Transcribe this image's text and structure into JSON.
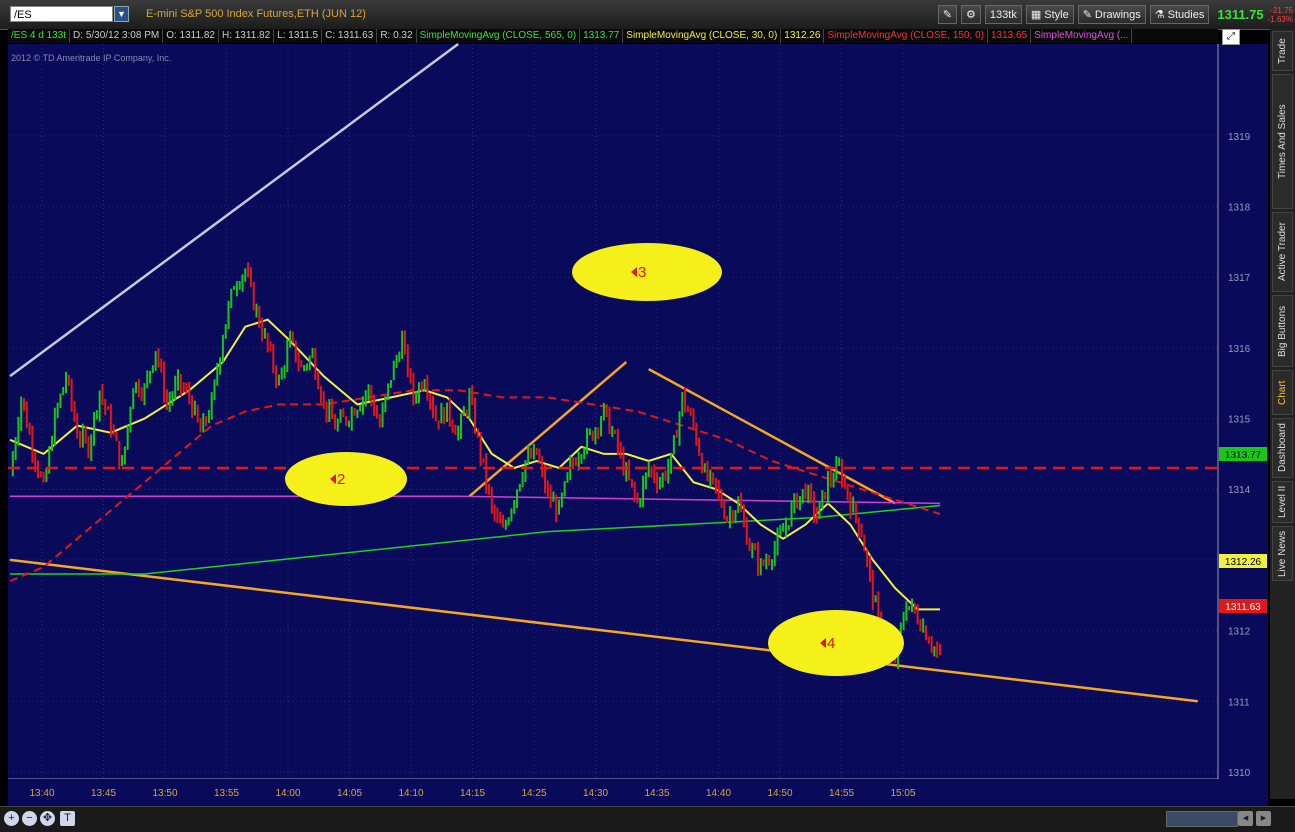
{
  "header": {
    "symbol": "/ES",
    "description": "E-mini S&P 500 Index Futures,ETH (JUN 12)",
    "aggregation": "133tk",
    "style_label": "Style",
    "drawings_label": "Drawings",
    "studies_label": "Studies",
    "last_price": "1311.75",
    "change": "-21.75",
    "change_pct": "-1.63%"
  },
  "infobar": {
    "period": "/ES 4 d 133t",
    "date": "D: 5/30/12 3:08 PM",
    "open": "O: 1311.82",
    "high": "H: 1311.82",
    "low": "L: 1311.5",
    "close": "C: 1311.63",
    "range": "R: 0.32",
    "sma565_label": "SimpleMovingAvg (CLOSE, 565, 0)",
    "sma565_val": "1313.77",
    "sma30_label": "SimpleMovingAvg (CLOSE, 30, 0)",
    "sma30_val": "1312.26",
    "sma150_label": "SimpleMovingAvg (CLOSE, 150, 0)",
    "sma150_val": "1313.65",
    "sma_other_label": "SimpleMovingAvg (..."
  },
  "copyright": "2012 © TD Ameritrade IP Company, Inc.",
  "side_tabs": [
    "Trade",
    "Times And Sales",
    "Active Trader",
    "Big Buttons",
    "Chart",
    "Dashboard",
    "Level II",
    "Live News"
  ],
  "price_tags": {
    "sma565": "1313.77",
    "sma30": "1312.26",
    "last": "1311.63"
  },
  "annotations": [
    "2",
    "3",
    "4"
  ],
  "colors": {
    "background": "#0a0a5a",
    "up_bar": "#19c619",
    "down_bar": "#e01818",
    "sma30": "#f0f040",
    "sma150": "#e01818",
    "sma565": "#1fd11f",
    "magenta_line": "#d040d0",
    "trendline": "#f5a623",
    "ellipse": "#f5f01a"
  },
  "chart_data": {
    "type": "line",
    "title": "",
    "xlabel": "",
    "ylabel": "",
    "ylim": [
      1309.9,
      1320.3
    ],
    "yticks": [
      1310,
      1311,
      1312,
      1313,
      1314,
      1315,
      1316,
      1317,
      1318,
      1319
    ],
    "x_tick_labels": [
      "13:40",
      "13:45",
      "13:50",
      "13:55",
      "14:00",
      "14:05",
      "14:10",
      "14:15",
      "14:25",
      "14:30",
      "14:35",
      "14:40",
      "14:50",
      "14:55",
      "15:05"
    ],
    "price_path": [
      [
        0,
        1314.2
      ],
      [
        1,
        1315.3
      ],
      [
        2,
        1314.6
      ],
      [
        3,
        1314.0
      ],
      [
        4,
        1315.0
      ],
      [
        5,
        1315.6
      ],
      [
        6,
        1314.8
      ],
      [
        7,
        1314.6
      ],
      [
        8,
        1315.4
      ],
      [
        9,
        1314.9
      ],
      [
        10,
        1314.3
      ],
      [
        11,
        1315.5
      ],
      [
        12,
        1315.4
      ],
      [
        13,
        1316.0
      ],
      [
        14,
        1315.2
      ],
      [
        15,
        1315.5
      ],
      [
        16,
        1315.3
      ],
      [
        17,
        1314.8
      ],
      [
        18,
        1315.2
      ],
      [
        19,
        1316.2
      ],
      [
        20,
        1316.9
      ],
      [
        21,
        1317.1
      ],
      [
        22,
        1316.5
      ],
      [
        23,
        1316.0
      ],
      [
        24,
        1315.5
      ],
      [
        25,
        1316.1
      ],
      [
        26,
        1315.7
      ],
      [
        27,
        1315.9
      ],
      [
        28,
        1315.2
      ],
      [
        29,
        1314.9
      ],
      [
        30,
        1315.0
      ],
      [
        31,
        1315.2
      ],
      [
        32,
        1315.4
      ],
      [
        33,
        1314.9
      ],
      [
        34,
        1315.6
      ],
      [
        35,
        1316.1
      ],
      [
        36,
        1315.3
      ],
      [
        37,
        1315.6
      ],
      [
        38,
        1315.0
      ],
      [
        39,
        1315.1
      ],
      [
        40,
        1314.8
      ],
      [
        41,
        1315.3
      ],
      [
        42,
        1314.5
      ],
      [
        43,
        1313.7
      ],
      [
        44,
        1313.4
      ],
      [
        45,
        1313.9
      ],
      [
        46,
        1314.4
      ],
      [
        47,
        1314.5
      ],
      [
        48,
        1313.9
      ],
      [
        49,
        1313.7
      ],
      [
        50,
        1314.3
      ],
      [
        51,
        1314.6
      ],
      [
        52,
        1314.8
      ],
      [
        53,
        1315.1
      ],
      [
        54,
        1314.7
      ],
      [
        55,
        1314.2
      ],
      [
        56,
        1313.8
      ],
      [
        57,
        1314.3
      ],
      [
        58,
        1314.1
      ],
      [
        59,
        1314.4
      ],
      [
        60,
        1315.3
      ],
      [
        61,
        1314.9
      ],
      [
        62,
        1314.2
      ],
      [
        63,
        1314.0
      ],
      [
        64,
        1313.6
      ],
      [
        65,
        1313.8
      ],
      [
        66,
        1313.2
      ],
      [
        67,
        1312.9
      ],
      [
        68,
        1313.1
      ],
      [
        69,
        1313.4
      ],
      [
        70,
        1313.8
      ],
      [
        71,
        1314.0
      ],
      [
        72,
        1313.6
      ],
      [
        73,
        1314.1
      ],
      [
        74,
        1314.3
      ],
      [
        75,
        1313.8
      ],
      [
        76,
        1313.4
      ],
      [
        77,
        1312.5
      ],
      [
        78,
        1311.8
      ],
      [
        79,
        1311.6
      ],
      [
        80,
        1312.4
      ],
      [
        81,
        1312.2
      ],
      [
        82,
        1311.9
      ],
      [
        83,
        1311.6
      ]
    ],
    "series": [
      {
        "name": "SimpleMovingAvg (CLOSE, 30, 0)",
        "points": [
          [
            0,
            1314.7
          ],
          [
            3,
            1314.5
          ],
          [
            6,
            1314.9
          ],
          [
            9,
            1314.8
          ],
          [
            12,
            1315.0
          ],
          [
            16,
            1315.4
          ],
          [
            19,
            1315.8
          ],
          [
            21,
            1316.3
          ],
          [
            23,
            1316.4
          ],
          [
            25,
            1316.1
          ],
          [
            28,
            1315.6
          ],
          [
            31,
            1315.2
          ],
          [
            34,
            1315.3
          ],
          [
            37,
            1315.4
          ],
          [
            39,
            1315.3
          ],
          [
            41,
            1315.0
          ],
          [
            43,
            1314.5
          ],
          [
            45,
            1314.3
          ],
          [
            47,
            1314.4
          ],
          [
            49,
            1314.3
          ],
          [
            51,
            1314.6
          ],
          [
            53,
            1314.5
          ],
          [
            55,
            1314.5
          ],
          [
            57,
            1314.4
          ],
          [
            59,
            1314.5
          ],
          [
            61,
            1314.1
          ],
          [
            63,
            1314.0
          ],
          [
            65,
            1313.8
          ],
          [
            67,
            1313.5
          ],
          [
            69,
            1313.3
          ],
          [
            71,
            1313.5
          ],
          [
            73,
            1313.8
          ],
          [
            75,
            1313.5
          ],
          [
            77,
            1313.0
          ],
          [
            79,
            1312.6
          ],
          [
            81,
            1312.3
          ],
          [
            83,
            1312.3
          ]
        ]
      },
      {
        "name": "SimpleMovingAvg (CLOSE, 150, 0)",
        "points": [
          [
            0,
            1312.7
          ],
          [
            3,
            1312.9
          ],
          [
            6,
            1313.3
          ],
          [
            9,
            1313.7
          ],
          [
            12,
            1314.1
          ],
          [
            15,
            1314.5
          ],
          [
            18,
            1314.9
          ],
          [
            21,
            1315.1
          ],
          [
            24,
            1315.2
          ],
          [
            28,
            1315.2
          ],
          [
            32,
            1315.3
          ],
          [
            36,
            1315.4
          ],
          [
            40,
            1315.4
          ],
          [
            44,
            1315.3
          ],
          [
            48,
            1315.3
          ],
          [
            52,
            1315.2
          ],
          [
            56,
            1315.1
          ],
          [
            60,
            1314.9
          ],
          [
            64,
            1314.7
          ],
          [
            68,
            1314.4
          ],
          [
            72,
            1314.2
          ],
          [
            76,
            1314.0
          ],
          [
            80,
            1313.8
          ],
          [
            83,
            1313.65
          ]
        ]
      },
      {
        "name": "SimpleMovingAvg (CLOSE, 565, 0)",
        "points": [
          [
            0,
            1312.8
          ],
          [
            12,
            1312.8
          ],
          [
            24,
            1313.0
          ],
          [
            36,
            1313.2
          ],
          [
            48,
            1313.4
          ],
          [
            60,
            1313.5
          ],
          [
            72,
            1313.6
          ],
          [
            83,
            1313.77
          ]
        ]
      },
      {
        "name": "SimpleMovingAvg (...",
        "points": [
          [
            0,
            1313.9
          ],
          [
            40,
            1313.9
          ],
          [
            83,
            1313.8
          ]
        ]
      }
    ],
    "horizontal_line": 1314.3,
    "trendlines": [
      {
        "from": [
          0,
          1313.0
        ],
        "to": [
          106,
          1311.0
        ],
        "color": "trendline"
      },
      {
        "from": [
          41,
          1313.9
        ],
        "to": [
          55,
          1315.8
        ],
        "color": "trendline"
      },
      {
        "from": [
          57,
          1315.7
        ],
        "to": [
          79,
          1313.8
        ],
        "color": "trendline"
      },
      {
        "from": [
          0,
          1315.6
        ],
        "to": [
          40,
          1320.3
        ],
        "color": "gray"
      }
    ]
  }
}
